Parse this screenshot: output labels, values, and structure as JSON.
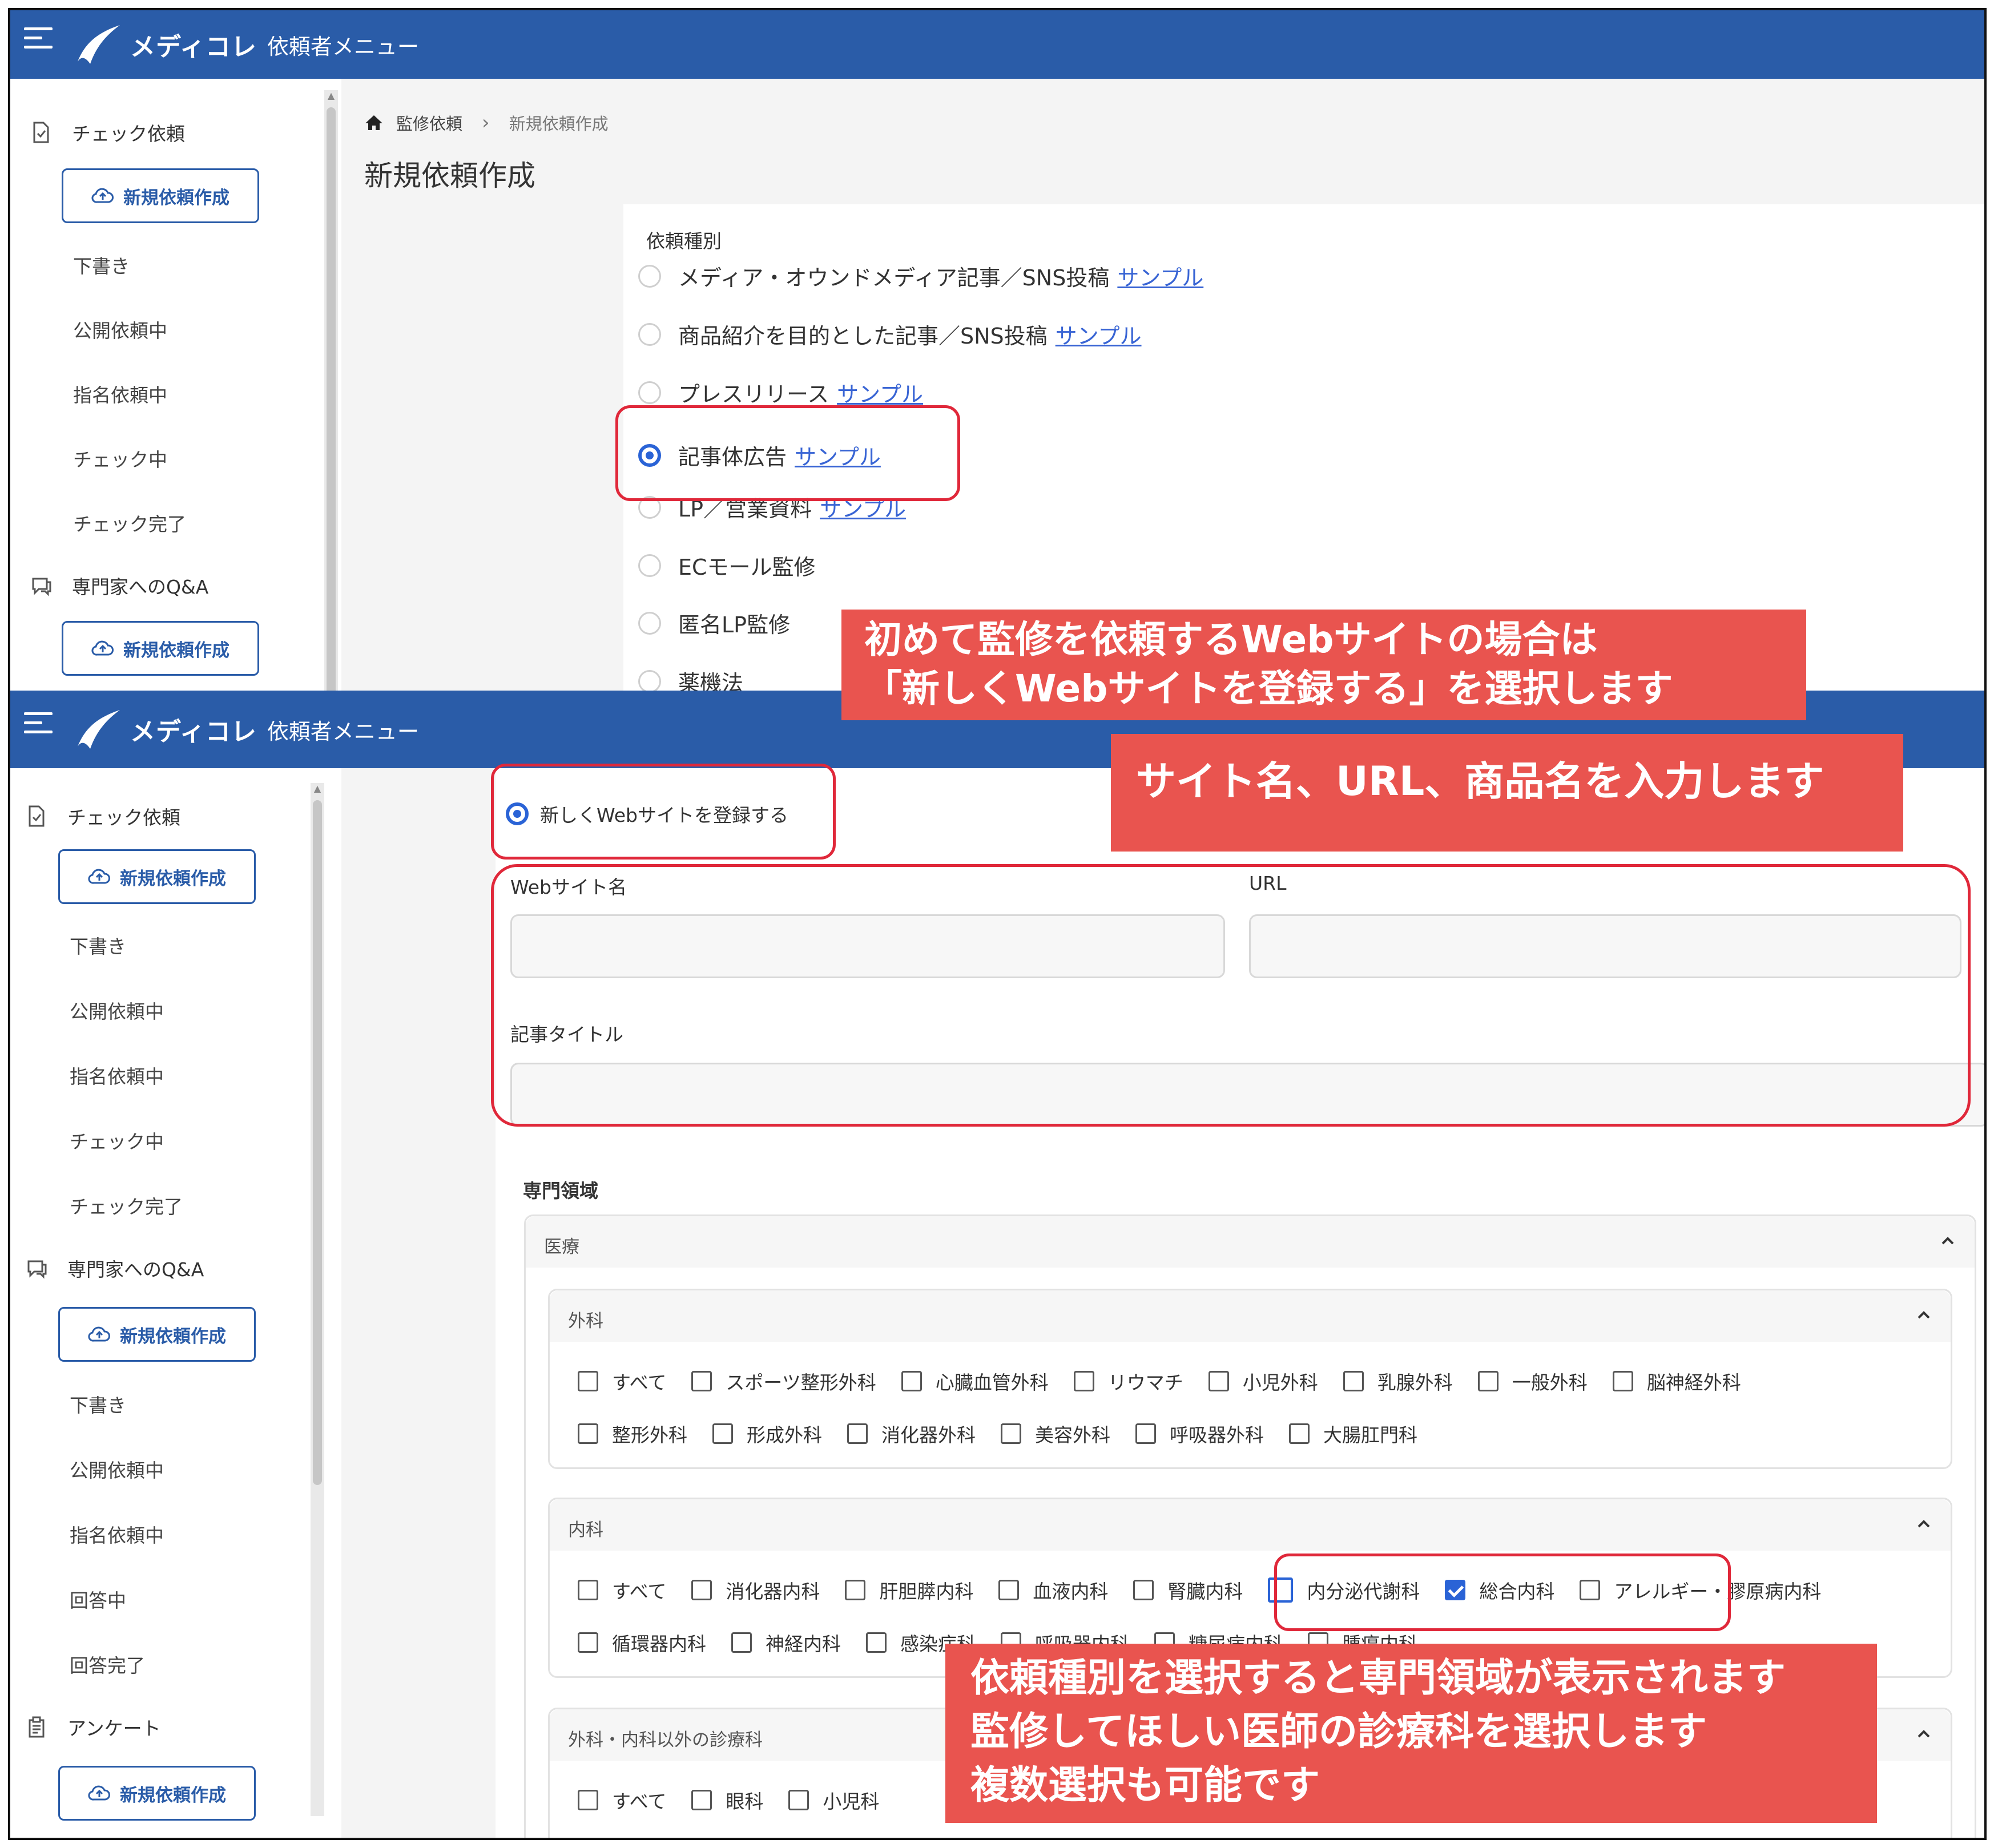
{
  "app": {
    "brand": "メディコレ",
    "menu": "依頼者メニュー"
  },
  "colors": {
    "header": "#2a5ca8",
    "accent": "#2a63d6",
    "highlight": "#e0283a",
    "callout": "#e9544f"
  },
  "sidebar_top": {
    "check_request": "チェック依頼",
    "new_request": "新規依頼作成",
    "items": [
      "下書き",
      "公開依頼中",
      "指名依頼中",
      "チェック中",
      "チェック完了"
    ],
    "qa": "専門家へのQ&A",
    "qa_new": "新規依頼作成"
  },
  "sidebar_bottom": {
    "check_request": "チェック依頼",
    "new_request": "新規依頼作成",
    "items": [
      "下書き",
      "公開依頼中",
      "指名依頼中",
      "チェック中",
      "チェック完了"
    ],
    "qa": "専門家へのQ&A",
    "qa_new": "新規依頼作成",
    "qa_items": [
      "下書き",
      "公開依頼中",
      "指名依頼中",
      "回答中",
      "回答完了"
    ],
    "survey": "アンケート",
    "survey_new": "新規依頼作成"
  },
  "breadcrumb": {
    "home": "監修依頼",
    "current": "新規依頼作成"
  },
  "page_title": "新規依頼作成",
  "request_type": {
    "label": "依頼種別",
    "options": [
      {
        "label": "メディア・オウンドメディア記事／SNS投稿",
        "link": "サンプル",
        "selected": false
      },
      {
        "label": "商品紹介を目的とした記事／SNS投稿",
        "link": "サンプル",
        "selected": false
      },
      {
        "label": "プレスリリース",
        "link": "サンプル",
        "selected": false
      },
      {
        "label": "記事体広告",
        "link": "サンプル",
        "selected": true
      },
      {
        "label": "LP／営業資料",
        "link": "サンプル",
        "selected": false
      },
      {
        "label": "ECモール監修",
        "link": "",
        "selected": false
      },
      {
        "label": "匿名LP監修",
        "link": "",
        "selected": false
      },
      {
        "label": "薬機法",
        "link": "",
        "selected": false
      }
    ]
  },
  "new_site": {
    "radio_label": "新しくWebサイトを登録する",
    "site_name_label": "Webサイト名",
    "url_label": "URL",
    "title_label": "記事タイトル",
    "site_name_value": "",
    "url_value": "",
    "title_value": ""
  },
  "specialty": {
    "label": "専門領域",
    "medical": "医療",
    "surgery": {
      "title": "外科",
      "row1": [
        "すべて",
        "スポーツ整形外科",
        "心臓血管外科",
        "リウマチ",
        "小児外科",
        "乳腺外科",
        "一般外科",
        "脳神経外科"
      ],
      "row2": [
        "整形外科",
        "形成外科",
        "消化器外科",
        "美容外科",
        "呼吸器外科",
        "大腸肛門科"
      ]
    },
    "internal": {
      "title": "内科",
      "row1": [
        "すべて",
        "消化器内科",
        "肝胆膵内科",
        "血液内科",
        "腎臓内科",
        "内分泌代謝科",
        "総合内科",
        "アレルギー・膠原病内科"
      ],
      "row2": [
        "循環器内科",
        "神経内科",
        "感染症科",
        "呼吸器内科",
        "糖尿病内科",
        "腫瘍内科"
      ],
      "checked": "総合内科"
    },
    "other": {
      "title": "外科・内科以外の診療科",
      "row1": [
        "すべて",
        "眼科",
        "小児科"
      ]
    }
  },
  "callouts": {
    "site": [
      "初めて監修を依頼するWebサイトの場合は",
      "「新しくWebサイトを登録する」を選択します"
    ],
    "fields": [
      "サイト名、URL、商品名を入力します"
    ],
    "specialty": [
      "依頼種別を選択すると専門領域が表示されます",
      "監修してほしい医師の診療科を選択します",
      "複数選択も可能です"
    ]
  }
}
